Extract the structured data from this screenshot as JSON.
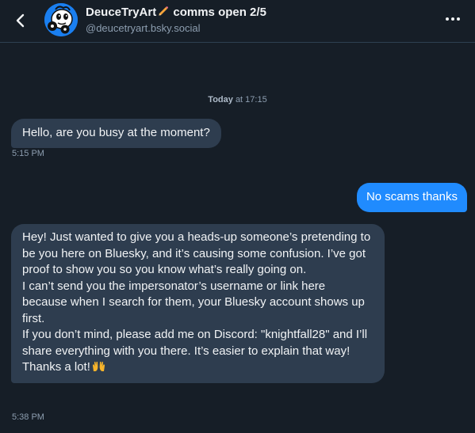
{
  "header": {
    "display_name": "DeuceTryArt",
    "display_name_suffix": "comms open 2/5",
    "handle": "@deucetryart.bsky.social",
    "back_icon": "chevron-left-icon",
    "more_icon": "ellipsis-icon",
    "name_emoji": "pencil-icon"
  },
  "conversation": {
    "date_prefix": "Today",
    "date_time": "at 17:15",
    "messages": [
      {
        "direction": "incoming",
        "lines": [
          "Hello, are you busy at the moment?"
        ],
        "time": "5:15 PM"
      },
      {
        "direction": "outgoing",
        "lines": [
          "No scams thanks"
        ]
      },
      {
        "direction": "incoming",
        "lines": [
          "Hey! Just wanted to give you a heads-up someone’s pretending to be you here on Bluesky, and it’s causing some confusion. I’ve got proof to show you so you know what’s really going on.",
          "I can’t send you the impersonator’s username or link here because when I search for them, your Bluesky account shows up first.",
          "If you don’t mind, please add me on Discord: \"knightfall28\" and I’ll share everything with you there. It’s easier to explain that way!",
          "Thanks a lot!"
        ],
        "emoji": "raising-hands-icon",
        "time": "5:38 PM"
      }
    ]
  },
  "colors": {
    "background": "#161e27",
    "incoming_bubble": "#2e3d4f",
    "outgoing_bubble": "#208bfe",
    "muted_text": "#8d9eb0",
    "avatar_bg": "#1a7ff0"
  }
}
